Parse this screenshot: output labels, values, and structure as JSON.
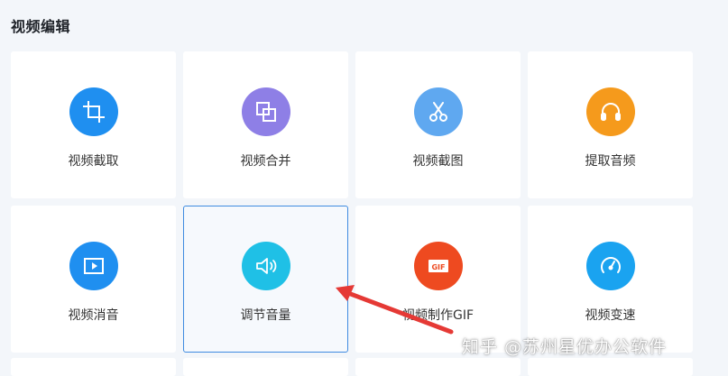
{
  "section_title": "视频编辑",
  "tools": [
    {
      "label": "视频截取",
      "icon": "crop-icon",
      "color": "#1f8ff0"
    },
    {
      "label": "视频合并",
      "icon": "merge-icon",
      "color": "#8e7fe6"
    },
    {
      "label": "视频截图",
      "icon": "scissors-icon",
      "color": "#5fa8f0"
    },
    {
      "label": "提取音频",
      "icon": "headphones-icon",
      "color": "#f59a1c"
    },
    {
      "label": "视频消音",
      "icon": "mute-video-icon",
      "color": "#1f8ff0"
    },
    {
      "label": "调节音量",
      "icon": "volume-icon",
      "color": "#1fc0e6",
      "selected": true
    },
    {
      "label": "视频制作GIF",
      "icon": "gif-icon",
      "color": "#ee4a20"
    },
    {
      "label": "视频变速",
      "icon": "speedometer-icon",
      "color": "#1aa3f0"
    }
  ],
  "annotation": {
    "arrow_color": "#e53935"
  },
  "watermark": "知乎 @苏州星优办公软件"
}
